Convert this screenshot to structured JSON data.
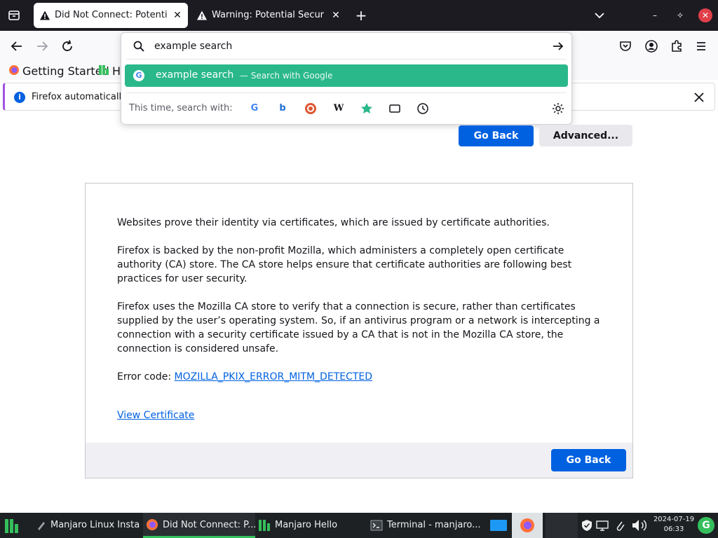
{
  "tabs": [
    {
      "title": "Did Not Connect: Potential Security Issue",
      "active": true
    },
    {
      "title": "Warning: Potential Security Risk Ahead",
      "active": false
    }
  ],
  "tab_strip": {
    "new_tab": "+",
    "minimize": "–",
    "restore": "✧",
    "close": "✕"
  },
  "urlbar": {
    "value": "example search",
    "suggestion": {
      "text": "example search",
      "action": "—  Search with Google"
    },
    "one_off_label": "This time, search with:",
    "engines": [
      "google-icon",
      "bing-icon",
      "duckduckgo-icon",
      "wikipedia-icon",
      "bookmarks-icon",
      "tabs-icon",
      "history-icon"
    ]
  },
  "bookmarks": [
    {
      "label": "Getting Started",
      "icon": "firefox-icon"
    },
    {
      "label": "He",
      "icon": "manjaro-icon"
    }
  ],
  "notification": {
    "text": "Firefox automatically"
  },
  "page": {
    "go_back_label": "Go Back",
    "advanced_label": "Advanced...",
    "advanced": {
      "p1": "Websites prove their identity via certificates, which are issued by certificate authorities.",
      "p2": "Firefox is backed by the non-profit Mozilla, which administers a completely open certificate authority (CA) store. The CA store helps ensure that certificate authorities are following best practices for user security.",
      "p3": "Firefox uses the Mozilla CA store to verify that a connection is secure, rather than certificates supplied by the user’s operating system. So, if an antivirus program or a network is intercepting a connection with a security certificate issued by a CA that is not in the Mozilla CA store, the connection is considered unsafe.",
      "error_prefix": "Error code: ",
      "error_code": "MOZILLA_PKIX_ERROR_MITM_DETECTED",
      "view_certificate": "View Certificate",
      "go_back_label": "Go Back"
    }
  },
  "taskbar": {
    "items": [
      {
        "label": "Manjaro Linux Insta...",
        "icon": "installer-icon",
        "active": false
      },
      {
        "label": "Did Not Connect: P...",
        "icon": "firefox-icon",
        "active": true
      },
      {
        "label": "Manjaro Hello",
        "icon": "manjaro-icon",
        "active": false
      },
      {
        "label": "Terminal - manjaro...",
        "icon": "terminal-icon",
        "active": false
      }
    ],
    "date": "2024-07-19",
    "time": "06:33",
    "avatar_letter": "G",
    "accent": "#35bf5c"
  },
  "colors": {
    "suggestion_bg": "#2ab88a",
    "primary_button": "#0061e0",
    "link": "#0061e0",
    "taskbar_bg": "#1e2124",
    "tabstrip_bg": "#1c1b22"
  }
}
